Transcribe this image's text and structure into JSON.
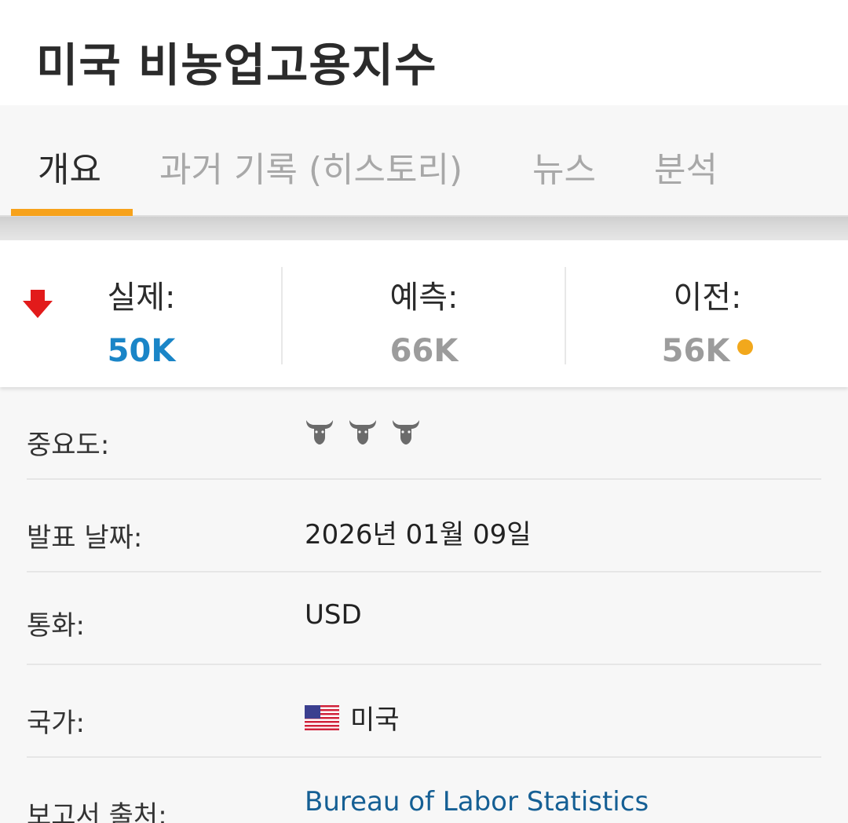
{
  "header": {
    "title": "미국 비농업고용지수"
  },
  "tabs": [
    {
      "label": "개요",
      "active": true
    },
    {
      "label": "과거 기록 (히스토리)",
      "active": false
    },
    {
      "label": "뉴스",
      "active": false
    },
    {
      "label": "분석",
      "active": false
    }
  ],
  "stats": {
    "trend_icon": "down-arrow-icon",
    "actual": {
      "label": "실제:",
      "value": "50K"
    },
    "forecast": {
      "label": "예측:",
      "value": "66K"
    },
    "previous": {
      "label": "이전:",
      "value": "56K"
    }
  },
  "details": {
    "importance": {
      "label": "중요도:",
      "level": 3,
      "max": 3,
      "icon": "bull-icon"
    },
    "release_date": {
      "label": "발표 날짜:",
      "value": "2026년 01월 09일"
    },
    "currency": {
      "label": "통화:",
      "value": "USD"
    },
    "country": {
      "label": "국가:",
      "value": "미국",
      "icon": "us-flag-icon"
    },
    "source": {
      "label": "보고서 출처:",
      "value": "Bureau of Labor Statistics"
    }
  },
  "colors": {
    "accent": "#f7a21b",
    "actual_value": "#1a85c7",
    "down_arrow": "#e21b1b",
    "previous_dot": "#f2a81c",
    "link": "#155f94"
  }
}
